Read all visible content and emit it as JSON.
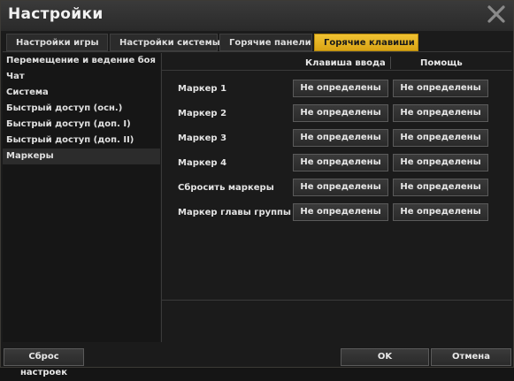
{
  "window": {
    "title": "Настройки"
  },
  "tabs": [
    {
      "label": "Настройки игры"
    },
    {
      "label": "Настройки системы"
    },
    {
      "label": "Горячие панели"
    },
    {
      "label": "Горячие клавиши"
    }
  ],
  "sidebar": {
    "items": [
      {
        "label": "Перемещение и ведение боя"
      },
      {
        "label": "Чат"
      },
      {
        "label": "Система"
      },
      {
        "label": "Быстрый доступ (осн.)"
      },
      {
        "label": "Быстрый доступ (доп. I)"
      },
      {
        "label": "Быстрый доступ (доп. II)"
      },
      {
        "label": "Маркеры"
      }
    ],
    "selected_index": 6
  },
  "content": {
    "columns": {
      "input": "Клавиша ввода",
      "help": "Помощь"
    },
    "rows": [
      {
        "label": "Маркер 1",
        "key": "Не определены",
        "help": "Не определены"
      },
      {
        "label": "Маркер 2",
        "key": "Не определены",
        "help": "Не определены"
      },
      {
        "label": "Маркер 3",
        "key": "Не определены",
        "help": "Не определены"
      },
      {
        "label": "Маркер 4",
        "key": "Не определены",
        "help": "Не определены"
      },
      {
        "label": "Сбросить маркеры",
        "key": "Не определены",
        "help": "Не определены"
      },
      {
        "label": "Маркер главы группы",
        "key": "Не определены",
        "help": "Не определены"
      }
    ]
  },
  "footer": {
    "reset_label": "Сброс настроек",
    "ok_label": "OK",
    "cancel_label": "Отмена"
  },
  "colors": {
    "accent": "#e6b422",
    "background": "#1b1b1b"
  },
  "icons": {
    "close": "close-icon"
  }
}
